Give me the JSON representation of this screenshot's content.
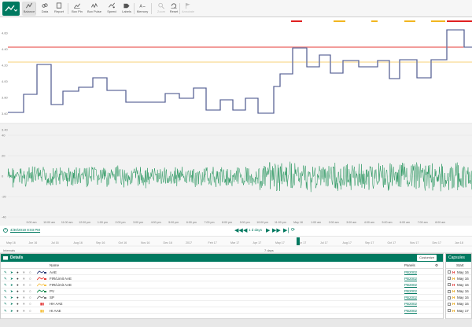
{
  "toolbar": {
    "buttons": [
      {
        "label": "Balance",
        "icon": "line-chart-icon",
        "active": true
      },
      {
        "label": "Data",
        "icon": "link-icon"
      },
      {
        "label": "Report",
        "icon": "report-icon"
      },
      {
        "label": "Box Pin",
        "icon": "chart-pin-icon"
      },
      {
        "label": "Box Pulse",
        "icon": "chart-pulse-icon"
      },
      {
        "label": "Speed",
        "icon": "speed-icon"
      },
      {
        "label": "Labels",
        "icon": "tag-icon"
      },
      {
        "label": "Memory",
        "icon": "text-icon"
      },
      {
        "label": "Zoom",
        "icon": "zoom-icon",
        "disabled": true
      },
      {
        "label": "Reset",
        "icon": "reset-icon"
      },
      {
        "label": "Annotate",
        "icon": "flag-icon",
        "disabled": true
      }
    ]
  },
  "chart": {
    "upper_ticks": [
      "4.60",
      "4.40",
      "4.20",
      "4.00",
      "3.80",
      "3.60",
      "3.40"
    ],
    "lower_ticks": [
      "40",
      "20",
      "0",
      "-20",
      "-40"
    ],
    "time_labels": [
      "9:00 am",
      "10:00 am",
      "11:00 am",
      "12:00 pm",
      "1:00 pm",
      "2:00 pm",
      "3:00 pm",
      "4:00 pm",
      "5:00 pm",
      "6:00 pm",
      "7:00 pm",
      "8:00 pm",
      "9:00 pm",
      "10:00 pm",
      "11:00 pm",
      "May 18",
      "1:00 am",
      "2:00 am",
      "3:00 am",
      "4:00 am",
      "5:00 am",
      "6:00 am",
      "7:00 am",
      "8:00 am"
    ],
    "colors": {
      "step_series": "#2b3a78",
      "noise_series": "#0f8a4c",
      "limit_red": "#e53935",
      "limit_yellow": "#f5c24a",
      "capsule_red": "#e02020",
      "capsule_yellow": "#f2b61f"
    }
  },
  "time_controls": {
    "start_date": "4/30/2019 8:03 PM",
    "duration": "1 d days"
  },
  "navigator": {
    "ticks": [
      "May 16",
      "Jun 16",
      "Jul 16",
      "Aug 16",
      "Sep 16",
      "Oct 16",
      "Nov 16",
      "Dec 16",
      "2017",
      "Feb 17",
      "Mar 17",
      "Apr 17",
      "May 17",
      "Jun 17",
      "Jul 17",
      "Aug 17",
      "Sep 17",
      "Oct 17",
      "Nov 17",
      "Dec 17",
      "Jan 18"
    ],
    "foot_left": "Intervals",
    "foot_mid": "7 days"
  },
  "details": {
    "title": "Details",
    "customize": "Customize",
    "col_name": "Name",
    "col_panels": "Panels",
    "rows": [
      {
        "name": "AAE",
        "panel": "PB2002",
        "color": "#2b3a78",
        "type": "series"
      },
      {
        "name": "FIR/Limit AAE",
        "panel": "PB2002",
        "color": "#e53935",
        "type": "series"
      },
      {
        "name": "FIR/Limit AAE",
        "panel": "PB2002",
        "color": "#f5c24a",
        "type": "series"
      },
      {
        "name": "PV",
        "panel": "PB2002",
        "color": "#0f8a4c",
        "type": "series"
      },
      {
        "name": "SP",
        "panel": "PB2002",
        "color": "#777777",
        "type": "series"
      },
      {
        "name": "HH AAE",
        "panel": "PB2002",
        "color": "#e02020",
        "type": "condition"
      },
      {
        "name": "HI AAE",
        "panel": "PB2002",
        "color": "#f2b61f",
        "type": "condition"
      }
    ]
  },
  "capsules": {
    "title": "Capsules",
    "col_start": "Start",
    "rows": [
      {
        "tag": "H",
        "start": "May 16",
        "red": true
      },
      {
        "tag": "H",
        "start": "May 16",
        "red": false
      },
      {
        "tag": "H",
        "start": "May 16",
        "red": true
      },
      {
        "tag": "H",
        "start": "May 16",
        "red": false
      },
      {
        "tag": "H",
        "start": "May 16",
        "red": false
      },
      {
        "tag": "H",
        "start": "May 16",
        "red": false
      },
      {
        "tag": "H",
        "start": "May 17",
        "red": false
      }
    ]
  }
}
